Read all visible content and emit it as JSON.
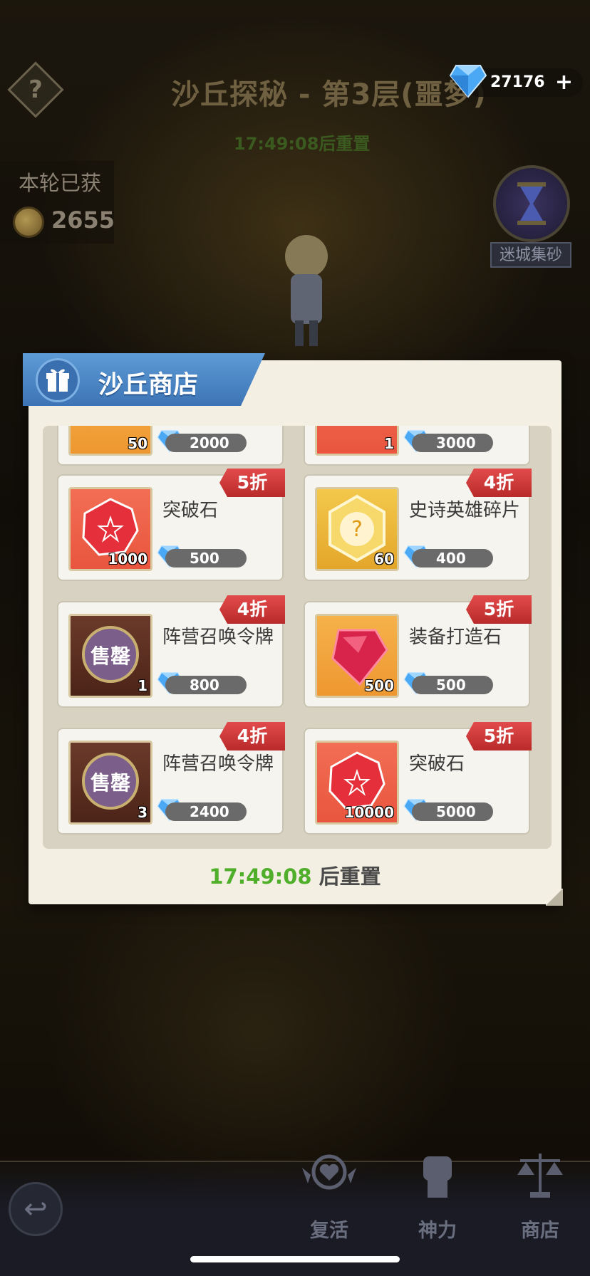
{
  "header": {
    "help_icon_text": "?",
    "floor_title": "沙丘探秘 - 第3层(噩梦)",
    "floor_timer": "17:49:08后重置",
    "gems": "27176",
    "add_label": "+"
  },
  "round": {
    "label": "本轮已获",
    "coins": "2655"
  },
  "side": {
    "hourglass_label": "迷城集砂"
  },
  "shop": {
    "title": "沙丘商店",
    "partial_row": [
      {
        "qty": "50",
        "price": "2000"
      },
      {
        "qty": "1",
        "price": "3000"
      }
    ],
    "items": [
      {
        "name": "突破石",
        "qty": "1000",
        "price": "500",
        "discount": "5折",
        "thumb": "red",
        "icon": "breakthrough-stone-icon"
      },
      {
        "name": "史诗英雄碎片",
        "qty": "60",
        "price": "400",
        "discount": "4折",
        "thumb": "gold",
        "icon": "epic-hero-shard-icon"
      },
      {
        "name": "阵营召唤令牌",
        "qty": "1",
        "price": "800",
        "discount": "4折",
        "thumb": "dark",
        "icon": "faction-token-icon"
      },
      {
        "name": "装备打造石",
        "qty": "500",
        "price": "500",
        "discount": "5折",
        "thumb": "orange",
        "icon": "forge-stone-icon"
      },
      {
        "name": "阵营召唤令牌",
        "qty": "3",
        "price": "2400",
        "discount": "4折",
        "thumb": "dark",
        "icon": "faction-token-icon"
      },
      {
        "name": "突破石",
        "qty": "10000",
        "price": "5000",
        "discount": "5折",
        "thumb": "red",
        "icon": "breakthrough-stone-icon"
      }
    ],
    "token_text": "售罄",
    "reset_time": "17:49:08",
    "reset_suffix": " 后重置"
  },
  "nav": {
    "back_glyph": "↩",
    "revive": "复活",
    "divine": "神力",
    "shop": "商店"
  },
  "colors": {
    "accent_blue": "#4a86c8",
    "discount_red": "#d43a3a",
    "timer_green": "#4fae2a"
  }
}
